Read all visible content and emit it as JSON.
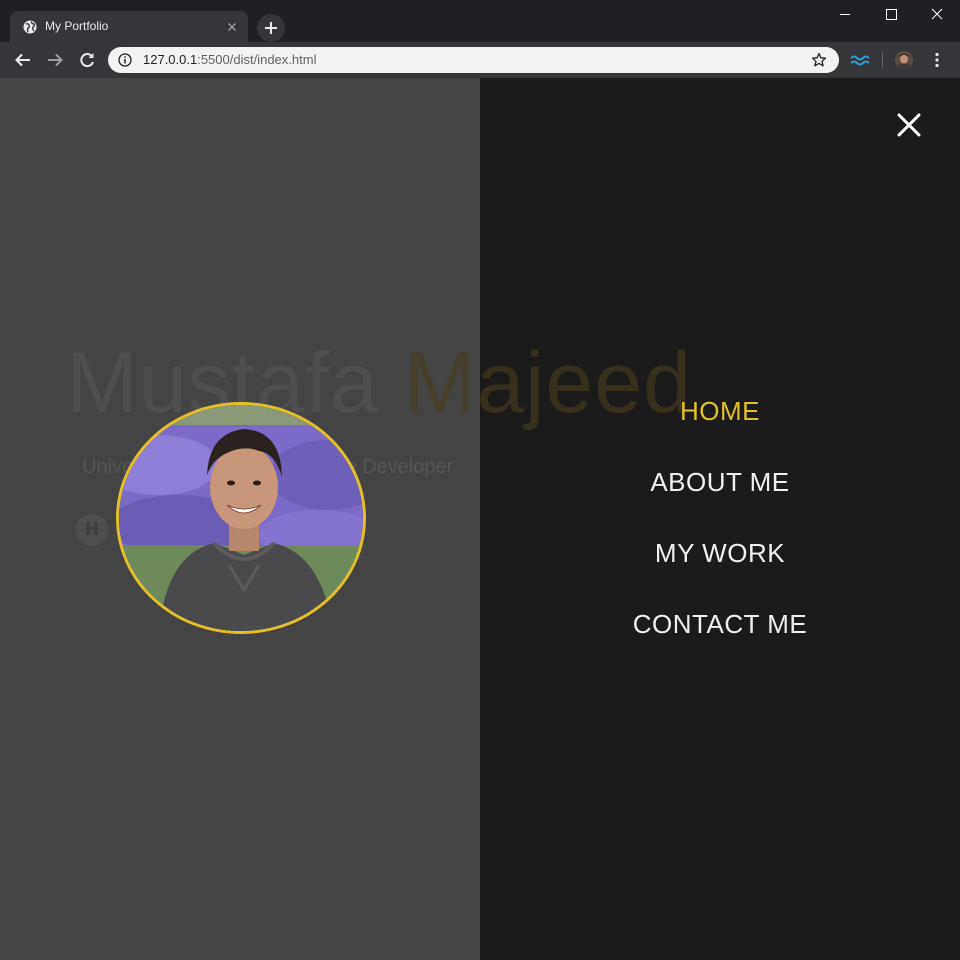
{
  "browser": {
    "tab_title": "My Portfolio",
    "url_host": "127.0.0.1",
    "url_rest": ":5500/dist/index.html"
  },
  "hero": {
    "first_name": "Mustafa",
    "last_name": "Majeed",
    "tagline": "University ... Student, Software Developer",
    "social_glyph": "H"
  },
  "menu": {
    "items": [
      {
        "label": "HOME",
        "active": true
      },
      {
        "label": "ABOUT ME",
        "active": false
      },
      {
        "label": "MY WORK",
        "active": false
      },
      {
        "label": "CONTACT ME",
        "active": false
      }
    ]
  },
  "colors": {
    "accent": "#e3c02a",
    "left_panel": "#444444",
    "right_panel": "#1b1b1b",
    "menu_text": "#f0f0f0"
  },
  "icons": [
    "globe-icon",
    "tab-close-icon",
    "plus-icon",
    "minimize-icon",
    "maximize-icon",
    "window-close-icon",
    "back-arrow-icon",
    "forward-arrow-icon",
    "reload-icon",
    "info-icon",
    "star-icon",
    "extension-icon",
    "kebab-menu-icon",
    "close-icon"
  ]
}
